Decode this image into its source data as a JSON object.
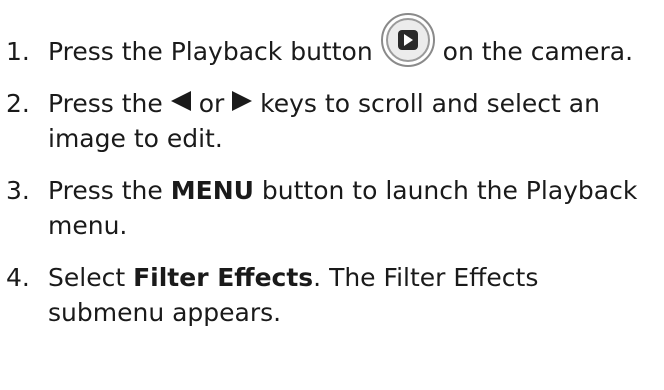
{
  "steps": [
    {
      "number": "1.",
      "text_before": "Press the Playback button",
      "icon": "playback-button-icon",
      "text_after": "on the camera."
    },
    {
      "number": "2.",
      "text_a": "Press the",
      "left_icon": "left-arrow-key-icon",
      "text_or": "or",
      "right_icon": "right-arrow-key-icon",
      "text_b": "keys to scroll and select an image to edit."
    },
    {
      "number": "3.",
      "text_a": "Press the",
      "bold": "MENU",
      "text_b": "button to launch the Playback menu."
    },
    {
      "number": "4.",
      "text_a": "Select",
      "bold": "Filter Effects",
      "text_b": ". The Filter Effects submenu appears."
    }
  ]
}
